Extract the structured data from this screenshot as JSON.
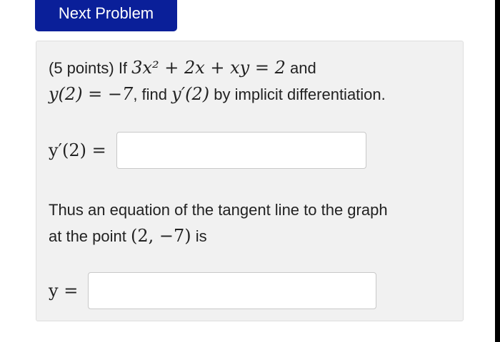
{
  "header": {
    "next_problem_label": "Next Problem"
  },
  "problem": {
    "points_prefix": "(5 points) If",
    "equation": "3x² + 2x + xy = 2",
    "and_word": "and",
    "condition": "y(2) = −7",
    "find_text": ", find",
    "find_target": "y′(2)",
    "method_text": "by implicit differentiation."
  },
  "answer1": {
    "label": "y′(2) =",
    "value": ""
  },
  "tangent": {
    "text_line1": "Thus an equation of the tangent line to the graph",
    "text_line2_prefix": "at the point",
    "point": "(2, −7)",
    "text_line2_suffix": "is"
  },
  "answer2": {
    "label": "y =",
    "value": ""
  },
  "colors": {
    "button_bg": "#0a1f99",
    "card_bg": "#f1f1f1"
  }
}
